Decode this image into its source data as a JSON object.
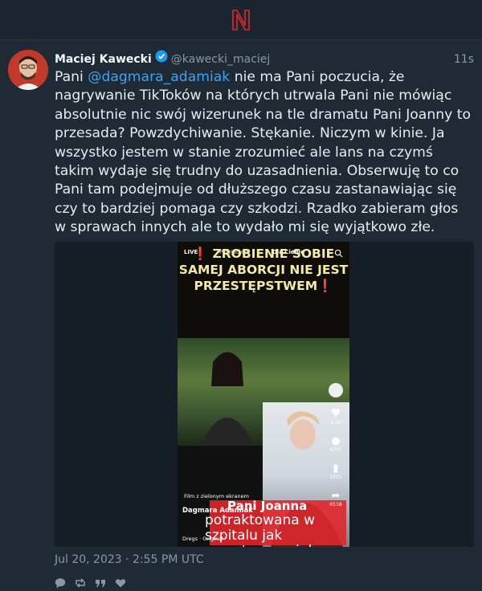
{
  "header": {
    "logo_icon": "nitter-logo-icon"
  },
  "tweet": {
    "author_name": "Maciej Kawecki",
    "handle": "@kawecki_maciej",
    "time_ago": "11s",
    "text_prefix": "Pani ",
    "mention": "@dagmara_adamiak",
    "text_body": " nie ma Pani poczucia, że nagrywanie TikToków na których utrwala Pani nie mówiąc absolutnie nic swój wizerunek na tle dramatu Pani Joanny to przesada? Powzdychiwanie. Stękanie. Niczym w kinie. Ja wszystko jestem w stanie zrozumieć ale lans na czymś takim wydaje się trudny do uzasadnienia. Obserwuję to co Pani tam podejmuje od dłuższego czasu zastanawiając się czy to bardziej pomaga czy szkodzi. Rzadko zabieram głos w sprawach innych ale to wydało mi się wyjątkowo złe.",
    "date": "Jul 20, 2023 · 2:55 PM UTC",
    "media": {
      "caption_excl_1": "❗",
      "caption": "ZROBIENIE SOBIE SAMEJ ABORCJI NIE JEST PRZESTĘPSTWEM",
      "caption_excl_2": "❗",
      "tab_live": "LIVE",
      "tab_friends": "Przyjaciele",
      "tab_foryou": "Dla Ciebie",
      "overlay_title": "Pani Joanna",
      "overlay_sub": "potraktowana w szpitalu jak przestępczyni, bo",
      "author": "Dagmara Adamiak",
      "film_label": "Film z zielonym ekranem",
      "music": "Dregs · Original",
      "rail": [
        "4.2K",
        "4707",
        "2615",
        "6518"
      ]
    }
  },
  "colors": {
    "background": "#1f2a34",
    "mention": "#3fa2f2",
    "logo": "#e0262b"
  }
}
